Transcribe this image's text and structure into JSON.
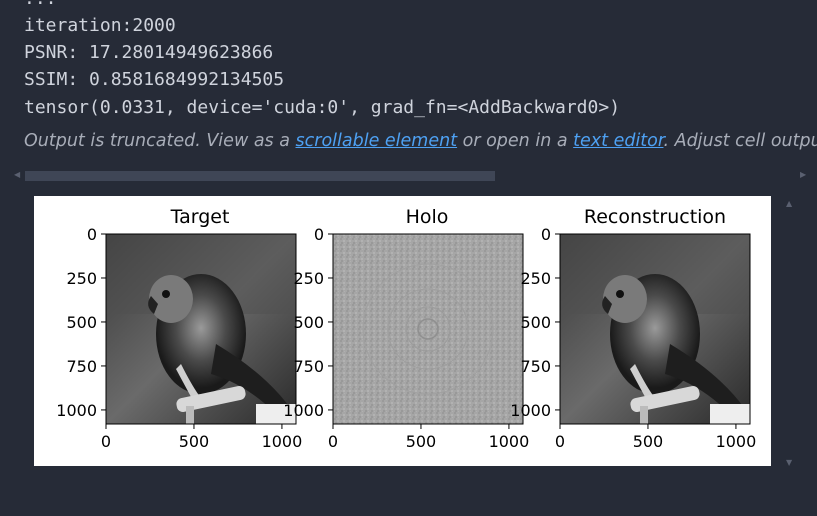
{
  "output": {
    "ellipsis": "...",
    "iteration": "iteration:2000",
    "psnr": "PSNR: 17.28014949623866",
    "ssim": "SSIM: 0.8581684992134505",
    "tensor": "tensor(0.0331, device='cuda:0', grad_fn=<AddBackward0>)"
  },
  "truncation": {
    "prefix": "Output is truncated. View as a ",
    "link1": "scrollable element",
    "middle": " or open in a ",
    "link2": "text editor",
    "suffix": ". Adjust cell output settings..."
  },
  "figure": {
    "panels": [
      {
        "title": "Target",
        "image": "parrot-grayscale"
      },
      {
        "title": "Holo",
        "image": "hologram-gray-noise"
      },
      {
        "title": "Reconstruction",
        "image": "parrot-grayscale"
      }
    ],
    "x_ticks": [
      "0",
      "500",
      "1000"
    ],
    "y_ticks": [
      "0",
      "250",
      "500",
      "750",
      "1000"
    ]
  },
  "colors": {
    "background": "#262b37",
    "text": "#cfd3dc",
    "link": "#4ea1f3",
    "scrollbar_thumb": "#3f4656"
  }
}
